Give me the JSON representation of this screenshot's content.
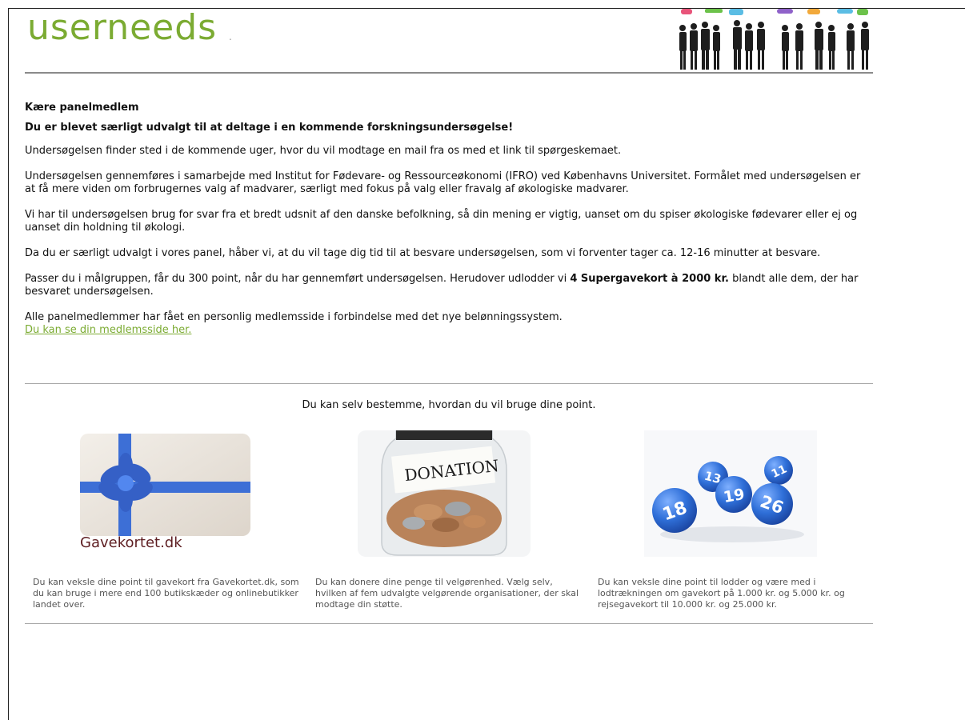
{
  "header": {
    "logo_text": "userneeds",
    "logo_dot": ".",
    "banner_icon": "people-silhouettes-icon"
  },
  "letter": {
    "greeting": "Kære panelmedlem",
    "headline": "Du er blevet særligt udvalgt til at deltage i en kommende forskningsundersøgelse!",
    "p1": "Undersøgelsen finder sted i de kommende uger, hvor du vil modtage en mail fra os med et link til spørgeskemaet.",
    "p2": "Undersøgelsen gennemføres i samarbejde med Institut for Fødevare- og Ressourceøkonomi (IFRO) ved Københavns Universitet. Formålet med undersøgelsen er at få mere viden om forbrugernes valg af madvarer, særligt med fokus på valg eller fravalg af økologiske madvarer.",
    "p3": "Vi har til undersøgelsen brug for svar fra et bredt udsnit af den danske befolkning, så din mening er vigtig, uanset om du spiser økologiske fødevarer eller ej og uanset din holdning til økologi.",
    "p4": "Da du er særligt udvalgt i vores panel, håber vi, at du vil tage dig tid til at besvare undersøgelsen, som vi forventer tager ca. 12-16 minutter at besvare.",
    "p5_before": "Passer du i målgruppen, får du 300 point, når du har gennemført undersøgelsen. Herudover udlodder vi ",
    "p5_bold": "4 Supergavekort à 2000 kr.",
    "p5_after": " blandt alle dem, der har besvaret undersøgelsen.",
    "p6": "Alle panelmedlemmer har fået en personlig medlemsside i forbindelse med det nye belønningssystem.",
    "link": "Du kan se din medlemsside her."
  },
  "rewards": {
    "title": "Du kan selv bestemme, hvordan du vil bruge dine point.",
    "items": [
      {
        "image_label": "Gavekortet.dk",
        "image_icon": "gift-card-bow-icon",
        "text": "Du kan veksle dine point til gavekort fra Gavekortet.dk, som du kan bruge i mere end 100 butikskæder og onlinebutikker landet over."
      },
      {
        "image_label": "DONATION",
        "image_icon": "donation-jar-icon",
        "text": "Du kan donere dine penge til velgørenhed. Vælg selv, hvilken af fem udvalgte velgørende organisationer, der skal modtage din støtte."
      },
      {
        "image_icon": "lottery-balls-icon",
        "ball_numbers": [
          "18",
          "13",
          "19",
          "26",
          "11"
        ],
        "text": "Du kan veksle dine point til lodder og være med i lodtrækningen om gavekort på 1.000 kr. og 5.000 kr. og rejsegavekort til 10.000 kr. og 25.000 kr."
      }
    ]
  },
  "colors": {
    "brand_green": "#7bab32",
    "bubble_colors": [
      "#e8547a",
      "#f2a93b",
      "#5bbde4",
      "#8f62c9",
      "#6cc24a"
    ],
    "ball_blue": "#2f6fd8"
  }
}
